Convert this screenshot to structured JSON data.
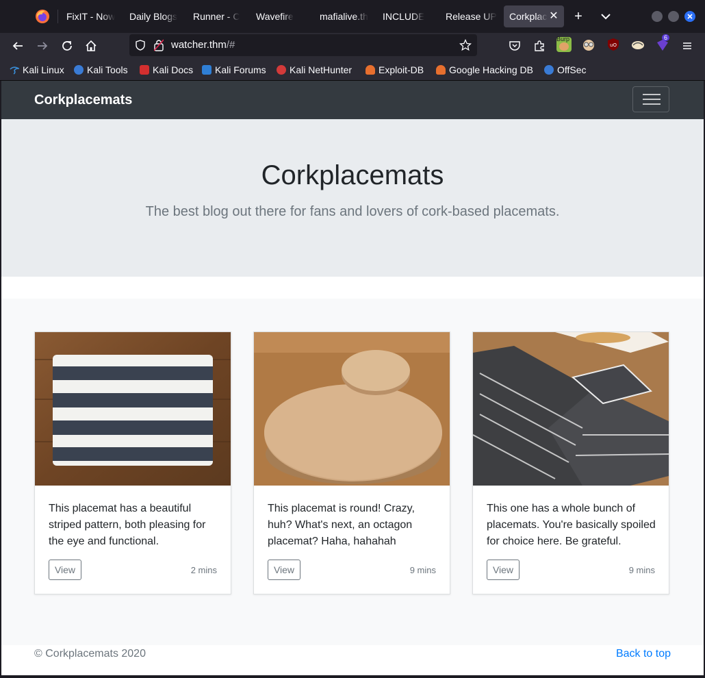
{
  "browser": {
    "tabs": [
      {
        "label": "FixIT - Now",
        "active": false
      },
      {
        "label": "Daily Blogs",
        "active": false
      },
      {
        "label": "Runner - C",
        "active": false
      },
      {
        "label": "Wavefire",
        "active": false
      },
      {
        "label": "mafialive.th",
        "active": false
      },
      {
        "label": "INCLUDE",
        "active": false
      },
      {
        "label": "Release UP",
        "active": false
      },
      {
        "label": "Corkplac",
        "active": true
      }
    ],
    "url_host": "watcher.thm",
    "url_rest": "/#",
    "extension_badge": "6",
    "burp_label": "Burp",
    "bookmarks": [
      {
        "label": "Kali Linux",
        "color": "#3a8ed8"
      },
      {
        "label": "Kali Tools",
        "color": "#3a7bd5"
      },
      {
        "label": "Kali Docs",
        "color": "#d32f2f"
      },
      {
        "label": "Kali Forums",
        "color": "#2f7fd6"
      },
      {
        "label": "Kali NetHunter",
        "color": "#d33a3a"
      },
      {
        "label": "Exploit-DB",
        "color": "#e76f2e"
      },
      {
        "label": "Google Hacking DB",
        "color": "#e76f2e"
      },
      {
        "label": "OffSec",
        "color": "#3a7bd5"
      }
    ]
  },
  "site": {
    "brand": "Corkplacemats",
    "hero_title": "Corkplacemats",
    "hero_lead": "The best blog out there for fans and lovers of cork-based placemats.",
    "cards": [
      {
        "text": "This placemat has a beautiful striped pattern, both pleasing for the eye and functional.",
        "button": "View",
        "time": "2 mins"
      },
      {
        "text": "This placemat is round! Crazy, huh? What's next, an octagon placemat? Haha, hahahah",
        "button": "View",
        "time": "9 mins"
      },
      {
        "text": "This one has a whole bunch of placemats. You're basically spoiled for choice here. Be grateful.",
        "button": "View",
        "time": "9 mins"
      }
    ],
    "footer_copy": "© Corkplacemats 2020",
    "footer_link": "Back to top"
  }
}
